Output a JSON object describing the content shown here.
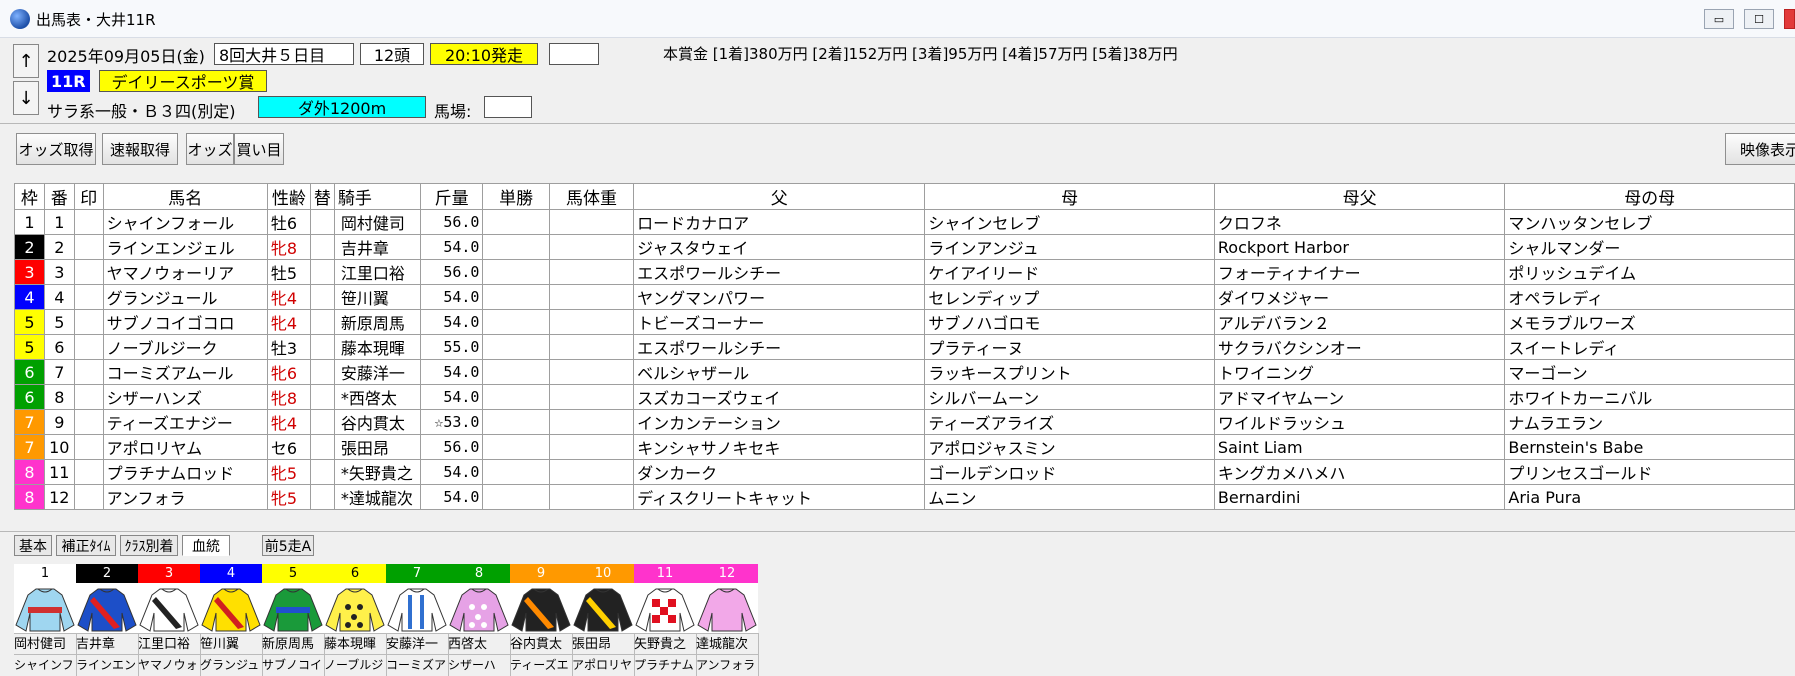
{
  "window": {
    "title": "出馬表・大井11R",
    "min_glyph": "▭",
    "max_glyph": "☐"
  },
  "header": {
    "up": "↑",
    "down": "↓",
    "date": "2025年09月05日(金)",
    "meeting": "8回大井５日目",
    "runners": "12頭",
    "post_time": "20:10発走",
    "extra_box": "",
    "race_no": "11R",
    "race_name": "デイリースポーツ賞",
    "race_class": "サラ系一般・Ｂ３四(別定)",
    "course": "ダ外1200m",
    "track_label": "馬場:",
    "track_value": "",
    "prize": "本賞金 [1着]380万円 [2着]152万円 [3着]95万円 [4着]57万円 [5着]38万円"
  },
  "toolbar": {
    "odds_fetch": "オッズ取得",
    "quick_fetch": "速報取得",
    "odds": "オッズ",
    "buy": "買い目",
    "video": "映像表示"
  },
  "colors": {
    "yellow_box": "#ffff00",
    "cyan_box": "#00ffff",
    "race_no_bg": "#0000ff"
  },
  "columns": [
    "枠",
    "番",
    "印",
    "馬名",
    "性齢",
    "替",
    "騎手",
    "斤量",
    "単勝",
    "馬体重",
    "父",
    "母",
    "母父",
    "母の母"
  ],
  "rows": [
    {
      "waku": "1",
      "num": "1",
      "mark": "",
      "name": "シャインフォール",
      "sex": "牡6",
      "mare": false,
      "jockey": "岡村健司",
      "weight": "56.0",
      "odds": "",
      "bw": "",
      "sire": "ロードカナロア",
      "dam": "シャインセレブ",
      "damsire": "クロフネ",
      "damdam": "マンハッタンセレブ"
    },
    {
      "waku": "2",
      "num": "2",
      "mark": "",
      "name": "ラインエンジェル",
      "sex": "牝8",
      "mare": true,
      "jockey": "吉井章",
      "weight": "54.0",
      "odds": "",
      "bw": "",
      "sire": "ジャスタウェイ",
      "dam": "ラインアンジュ",
      "damsire": "Rockport Harbor",
      "damdam": "シャルマンダー"
    },
    {
      "waku": "3",
      "num": "3",
      "mark": "",
      "name": "ヤマノウォーリア",
      "sex": "牡5",
      "mare": false,
      "jockey": "江里口裕",
      "weight": "56.0",
      "odds": "",
      "bw": "",
      "sire": "エスポワールシチー",
      "dam": "ケイアイリード",
      "damsire": "フォーティナイナー",
      "damdam": "ポリッシュデイム"
    },
    {
      "waku": "4",
      "num": "4",
      "mark": "",
      "name": "グランジュール",
      "sex": "牝4",
      "mare": true,
      "jockey": "笹川翼",
      "weight": "54.0",
      "odds": "",
      "bw": "",
      "sire": "ヤングマンパワー",
      "dam": "セレンディップ",
      "damsire": "ダイワメジャー",
      "damdam": "オペラレディ"
    },
    {
      "waku": "5",
      "num": "5",
      "mark": "",
      "name": "サブノコイゴコロ",
      "sex": "牝4",
      "mare": true,
      "jockey": "新原周馬",
      "weight": "54.0",
      "odds": "",
      "bw": "",
      "sire": "トビーズコーナー",
      "dam": "サブノハゴロモ",
      "damsire": "アルデバラン２",
      "damdam": "メモラブルワーズ"
    },
    {
      "waku": "5",
      "num": "6",
      "mark": "",
      "name": "ノーブルジーク",
      "sex": "牡3",
      "mare": false,
      "jockey": "藤本現暉",
      "weight": "55.0",
      "odds": "",
      "bw": "",
      "sire": "エスポワールシチー",
      "dam": "プラティーヌ",
      "damsire": "サクラバクシンオー",
      "damdam": "スイートレディ"
    },
    {
      "waku": "6",
      "num": "7",
      "mark": "",
      "name": "コーミズアムール",
      "sex": "牝6",
      "mare": true,
      "jockey": "安藤洋一",
      "weight": "54.0",
      "odds": "",
      "bw": "",
      "sire": "ベルシャザール",
      "dam": "ラッキースプリント",
      "damsire": "トワイニング",
      "damdam": "マーゴーン"
    },
    {
      "waku": "6",
      "num": "8",
      "mark": "",
      "name": "シザーハンズ",
      "sex": "牝8",
      "mare": true,
      "jockey": "*西啓太",
      "weight": "54.0",
      "odds": "",
      "bw": "",
      "sire": "スズカコーズウェイ",
      "dam": "シルバームーン",
      "damsire": "アドマイヤムーン",
      "damdam": "ホワイトカーニバル"
    },
    {
      "waku": "7",
      "num": "9",
      "mark": "",
      "name": "ティーズエナジー",
      "sex": "牝4",
      "mare": true,
      "jockey": "谷内貫太",
      "weight": "☆53.0",
      "odds": "",
      "bw": "",
      "sire": "インカンテーション",
      "dam": "ティーズアライズ",
      "damsire": "ワイルドラッシュ",
      "damdam": "ナムラエラン"
    },
    {
      "waku": "7",
      "num": "10",
      "mark": "",
      "name": "アポロリヤム",
      "sex": "セ6",
      "mare": false,
      "jockey": "張田昂",
      "weight": "56.0",
      "odds": "",
      "bw": "",
      "sire": "キンシャサノキセキ",
      "dam": "アポロジャスミン",
      "damsire": "Saint Liam",
      "damdam": "Bernstein's Babe"
    },
    {
      "waku": "8",
      "num": "11",
      "mark": "",
      "name": "プラチナムロッド",
      "sex": "牝5",
      "mare": true,
      "jockey": "*矢野貴之",
      "weight": "54.0",
      "odds": "",
      "bw": "",
      "sire": "ダンカーク",
      "dam": "ゴールデンロッド",
      "damsire": "キングカメハメハ",
      "damdam": "プリンセスゴールド"
    },
    {
      "waku": "8",
      "num": "12",
      "mark": "",
      "name": "アンフォラ",
      "sex": "牝5",
      "mare": true,
      "jockey": "*達城龍次",
      "weight": "54.0",
      "odds": "",
      "bw": "",
      "sire": "ディスクリートキャット",
      "dam": "ムニン",
      "damsire": "Bernardini",
      "damdam": "Aria Pura"
    }
  ],
  "waku_colors": {
    "1": {
      "bg": "#ffffff",
      "fg": "#000000"
    },
    "2": {
      "bg": "#000000",
      "fg": "#ffffff"
    },
    "3": {
      "bg": "#ff0000",
      "fg": "#ffffff"
    },
    "4": {
      "bg": "#0000ff",
      "fg": "#ffffff"
    },
    "5": {
      "bg": "#ffff00",
      "fg": "#000000"
    },
    "6": {
      "bg": "#00a000",
      "fg": "#ffffff"
    },
    "7": {
      "bg": "#ff9900",
      "fg": "#ffffff"
    },
    "8": {
      "bg": "#ff33cc",
      "fg": "#ffffff"
    }
  },
  "lower_tabs": [
    "基本",
    "補正ﾀｲﾑ",
    "ｸﾗｽ別着",
    "血統",
    "前5走A"
  ],
  "active_tab": "血統",
  "silks": [
    {
      "num": "1",
      "jockey": "岡村健司",
      "horse": "シャインフ",
      "body": "#9fd6f0",
      "trim": "#d03030",
      "pattern": "band"
    },
    {
      "num": "2",
      "jockey": "吉井章",
      "horse": "ラインエン",
      "body": "#1d4fc8",
      "trim": "#e02020",
      "pattern": "sash"
    },
    {
      "num": "3",
      "jockey": "江里口裕",
      "horse": "ヤマノウォ",
      "body": "#ffffff",
      "trim": "#222222",
      "pattern": "sash"
    },
    {
      "num": "4",
      "jockey": "笹川翼",
      "horse": "グランジュ",
      "body": "#ffe000",
      "trim": "#d02020",
      "pattern": "sash"
    },
    {
      "num": "5",
      "jockey": "新原周馬",
      "horse": "サブノコイ",
      "body": "#1a9a3a",
      "trim": "#2050d0",
      "pattern": "band"
    },
    {
      "num": "6",
      "jockey": "藤本現暉",
      "horse": "ノーブルジ",
      "body": "#fff04a",
      "trim": "#222222",
      "pattern": "dots"
    },
    {
      "num": "7",
      "jockey": "安藤洋一",
      "horse": "コーミズア",
      "body": "#ffffff",
      "trim": "#3070d0",
      "pattern": "stripes"
    },
    {
      "num": "8",
      "jockey": "西啓太",
      "horse": "シザーハ",
      "body": "#e6a2e6",
      "trim": "#ffffff",
      "pattern": "dots"
    },
    {
      "num": "9",
      "jockey": "谷内貫太",
      "horse": "ティーズエ",
      "body": "#222222",
      "trim": "#ff8a00",
      "pattern": "sash"
    },
    {
      "num": "10",
      "jockey": "張田昂",
      "horse": "アポロリヤ",
      "body": "#222222",
      "trim": "#ffd000",
      "pattern": "sash"
    },
    {
      "num": "11",
      "jockey": "矢野貴之",
      "horse": "プラチナム",
      "body": "#ffffff",
      "trim": "#e01020",
      "pattern": "check"
    },
    {
      "num": "12",
      "jockey": "達城龍次",
      "horse": "アンフォラ",
      "body": "#f2a8e8",
      "trim": "#333333",
      "pattern": "plain"
    }
  ]
}
